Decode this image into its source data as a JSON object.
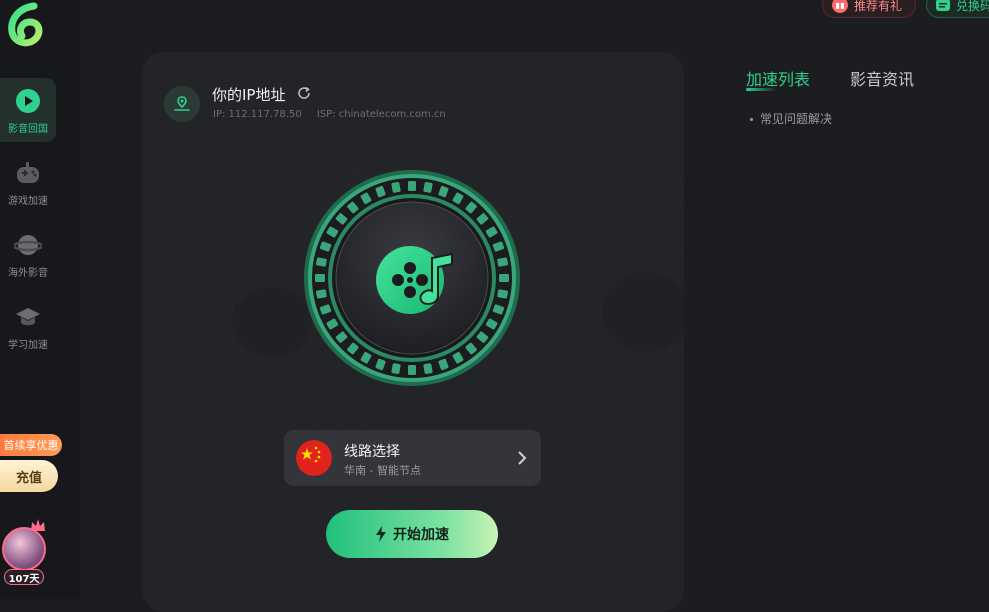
{
  "sidebar": {
    "items": [
      {
        "label": "影音回国",
        "icon": "play-icon",
        "active": true
      },
      {
        "label": "游戏加速",
        "icon": "gamepad-icon",
        "active": false
      },
      {
        "label": "海外影音",
        "icon": "planet-icon",
        "active": false
      },
      {
        "label": "学习加速",
        "icon": "graduation-cap-icon",
        "active": false
      }
    ],
    "promo_badge": "首续享优惠",
    "recharge_label": "充值",
    "days_badge": "107天"
  },
  "top": {
    "referral_label": "推荐有礼",
    "redeem_label": "兑换码"
  },
  "ip_panel": {
    "title": "你的IP地址",
    "ip": "IP: 112.117.78.50",
    "isp": "ISP: chinatelecom.com.cn"
  },
  "route": {
    "title": "线路选择",
    "subtitle": "华南 - 智能节点"
  },
  "start_button_label": "开始加速",
  "right_panel": {
    "tabs": [
      {
        "label": "加速列表",
        "active": true
      },
      {
        "label": "影音资讯",
        "active": false
      }
    ],
    "faq_items": [
      "常见问题解决"
    ]
  },
  "colors": {
    "accent": "#2fd18e",
    "background": "#1c1d21",
    "card": "#232428",
    "route_card": "#33353b"
  }
}
